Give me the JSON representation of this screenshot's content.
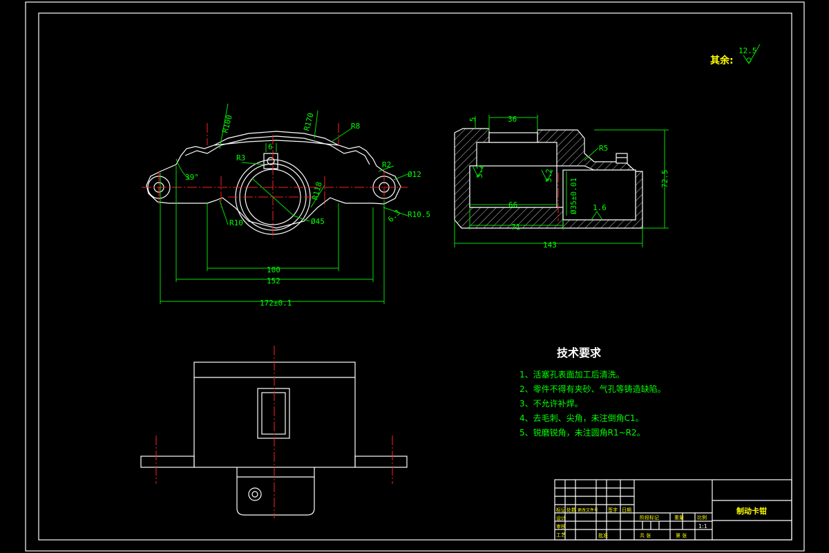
{
  "surface_finish": {
    "label": "其余:",
    "value": "12.5"
  },
  "front_view": {
    "dims": {
      "r100": "R100",
      "r170": "R170",
      "r8": "R8",
      "r3": "R3",
      "e6": "6",
      "r2": "R2",
      "phi12": "Ø12",
      "angle39": "39°",
      "r118": "R118",
      "r10": "R10",
      "phi45": "Ø45",
      "r105": "R10.5",
      "rough_small": "6.3",
      "d100": "100",
      "d152": "152",
      "d172": "172±0.1"
    }
  },
  "section_view": {
    "dims": {
      "d5": "5",
      "d36": "36",
      "r5": "R5",
      "rough1": "3.2",
      "rough2": "3.2",
      "rough3": "1.6",
      "phi": "Ø35±0.01",
      "d66": "66",
      "d71": "71",
      "d143": "143",
      "d725": "72.5"
    }
  },
  "tech_req": {
    "title": "技术要求",
    "items": [
      "1、活塞孔表面加工后清洗。",
      "2、零件不得有夹砂、气孔等铸造缺陷。",
      "3、不允许补焊。",
      "4、去毛刺、尖角，未注倒角C1。",
      "5、锐磨锐角，未注圆角R1~R2。"
    ]
  },
  "title_block": {
    "part_name": "制动卡钳",
    "labels": [
      "标记",
      "处数",
      "更改文件号",
      "签字",
      "日期",
      "阶段标记",
      "重量",
      "比例",
      "设计",
      "审核",
      "工艺",
      "共 张",
      "第 张",
      "批准"
    ],
    "scale": "1:1"
  }
}
